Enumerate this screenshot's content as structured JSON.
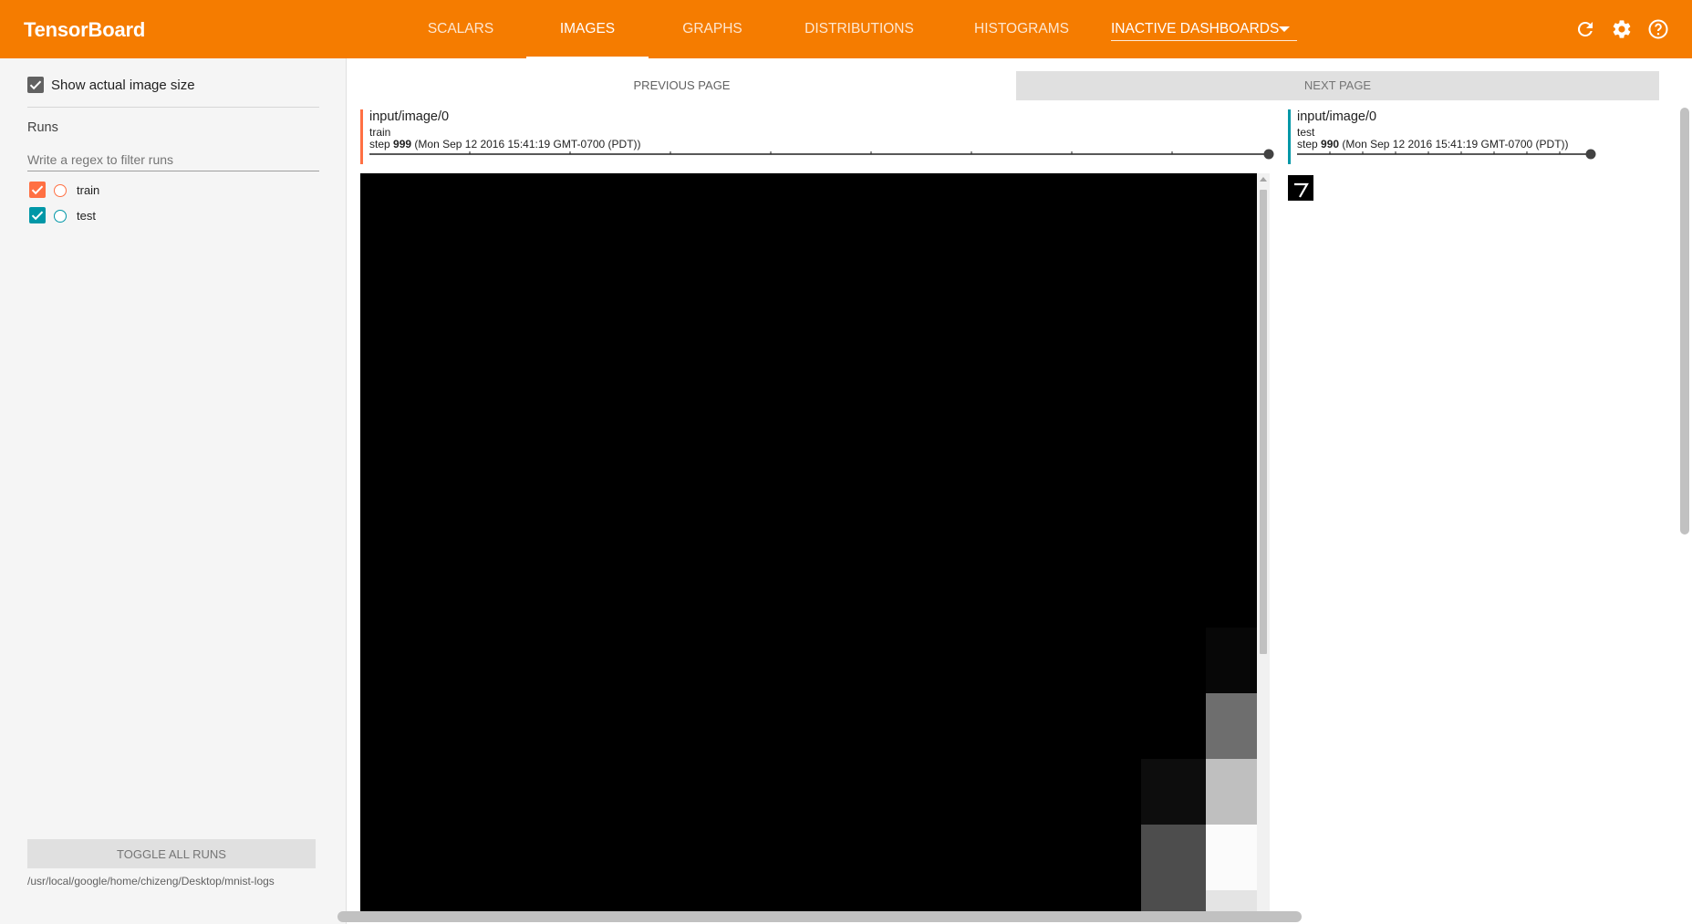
{
  "app": {
    "title": "TensorBoard",
    "accent_color": "#f57c00"
  },
  "nav": {
    "tabs": [
      {
        "label": "SCALARS",
        "active": false
      },
      {
        "label": "IMAGES",
        "active": true
      },
      {
        "label": "GRAPHS",
        "active": false
      },
      {
        "label": "DISTRIBUTIONS",
        "active": false
      },
      {
        "label": "HISTOGRAMS",
        "active": false
      }
    ],
    "inactive_dashboards": {
      "label": "INACTIVE DASHBOARDS"
    },
    "icons": [
      "refresh-icon",
      "settings-gear-icon",
      "help-icon"
    ]
  },
  "sidebar": {
    "show_actual_size": {
      "label": "Show actual image size",
      "checked": true
    },
    "runs_title": "Runs",
    "regex_placeholder": "Write a regex to filter runs",
    "runs": [
      {
        "name": "train",
        "checked": true,
        "color": "#ff7043"
      },
      {
        "name": "test",
        "checked": true,
        "color": "#0097a7"
      }
    ],
    "toggle_all_label": "TOGGLE ALL RUNS",
    "logdir": "/usr/local/google/home/chizeng/Desktop/mnist-logs"
  },
  "main": {
    "prev_page": "PREVIOUS PAGE",
    "next_page": "NEXT PAGE",
    "cards": [
      {
        "tag": "input/image/0",
        "run": "train",
        "step_label": "step",
        "step": "999",
        "time": "(Mon Sep 12 2016 15:41:19 GMT-0700 (PDT))",
        "color": "#ff7043",
        "slider_position": 1.0
      },
      {
        "tag": "input/image/0",
        "run": "test",
        "step_label": "step",
        "step": "990",
        "time": "(Mon Sep 12 2016 15:41:19 GMT-0700 (PDT))",
        "color": "#0097a7",
        "slider_position": 1.0
      }
    ],
    "test_image_digit": "7"
  }
}
